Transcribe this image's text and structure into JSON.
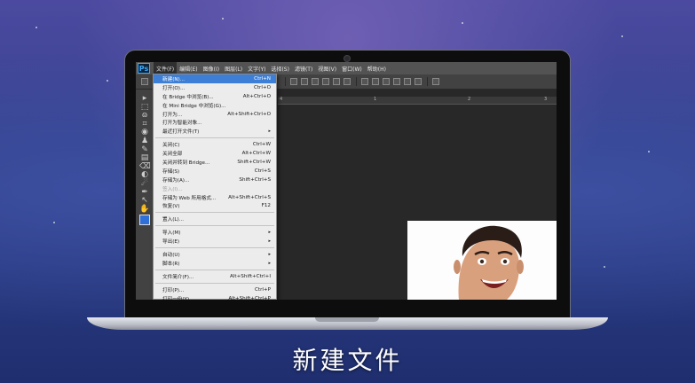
{
  "app": {
    "logo_text": "Ps"
  },
  "menubar": {
    "items": [
      {
        "label": "文件(F)",
        "active": true
      },
      {
        "label": "编辑(E)"
      },
      {
        "label": "图像(I)"
      },
      {
        "label": "图层(L)"
      },
      {
        "label": "文字(Y)"
      },
      {
        "label": "选择(S)"
      },
      {
        "label": "滤镜(T)"
      },
      {
        "label": "视图(V)"
      },
      {
        "label": "窗口(W)"
      },
      {
        "label": "帮助(H)"
      }
    ]
  },
  "ruler": {
    "ticks": [
      "4",
      "1",
      "2",
      "3"
    ]
  },
  "file_menu": {
    "groups": [
      [
        {
          "label": "新建(N)...",
          "shortcut": "Ctrl+N",
          "highlight": true
        },
        {
          "label": "打开(O)...",
          "shortcut": "Ctrl+O"
        },
        {
          "label": "在 Bridge 中浏览(B)...",
          "shortcut": "Alt+Ctrl+O"
        },
        {
          "label": "在 Mini Bridge 中浏览(G)...",
          "shortcut": ""
        },
        {
          "label": "打开为...",
          "shortcut": "Alt+Shift+Ctrl+O"
        },
        {
          "label": "打开为智能对象...",
          "shortcut": ""
        },
        {
          "label": "最近打开文件(T)",
          "shortcut": "",
          "submenu": true
        }
      ],
      [
        {
          "label": "关闭(C)",
          "shortcut": "Ctrl+W"
        },
        {
          "label": "关闭全部",
          "shortcut": "Alt+Ctrl+W"
        },
        {
          "label": "关闭并转到 Bridge...",
          "shortcut": "Shift+Ctrl+W"
        },
        {
          "label": "存储(S)",
          "shortcut": "Ctrl+S"
        },
        {
          "label": "存储为(A)...",
          "shortcut": "Shift+Ctrl+S"
        },
        {
          "label": "签入(I)...",
          "shortcut": "",
          "disabled": true
        },
        {
          "label": "存储为 Web 所用格式...",
          "shortcut": "Alt+Shift+Ctrl+S"
        },
        {
          "label": "恢复(V)",
          "shortcut": "F12"
        }
      ],
      [
        {
          "label": "置入(L)...",
          "shortcut": ""
        }
      ],
      [
        {
          "label": "导入(M)",
          "shortcut": "",
          "submenu": true
        },
        {
          "label": "导出(E)",
          "shortcut": "",
          "submenu": true
        }
      ],
      [
        {
          "label": "自动(U)",
          "shortcut": "",
          "submenu": true
        },
        {
          "label": "脚本(R)",
          "shortcut": "",
          "submenu": true
        }
      ],
      [
        {
          "label": "文件简介(F)...",
          "shortcut": "Alt+Shift+Ctrl+I"
        }
      ],
      [
        {
          "label": "打印(P)...",
          "shortcut": "Ctrl+P"
        },
        {
          "label": "打印一份(Y)",
          "shortcut": "Alt+Shift+Ctrl+P"
        }
      ]
    ],
    "submenu_arrow": "▸"
  },
  "tools": {
    "icons": [
      "move-tool-icon",
      "marquee-tool-icon",
      "lasso-tool-icon",
      "crop-tool-icon",
      "eyedropper-tool-icon",
      "healing-tool-icon",
      "brush-tool-icon",
      "stamp-tool-icon",
      "eraser-tool-icon",
      "gradient-tool-icon",
      "blur-tool-icon",
      "pen-tool-icon",
      "path-select-tool-icon",
      "hand-tool-icon"
    ],
    "glyphs": [
      "▸",
      "⬚",
      "ɷ",
      "⌗",
      "◉",
      "♟",
      "✎",
      "▤",
      "⌫",
      "◐",
      "☄",
      "✒",
      "↖",
      "✋"
    ],
    "foreground_color": "#2f6fd8",
    "background_color": "#ffffff"
  },
  "caption": "新建文件"
}
